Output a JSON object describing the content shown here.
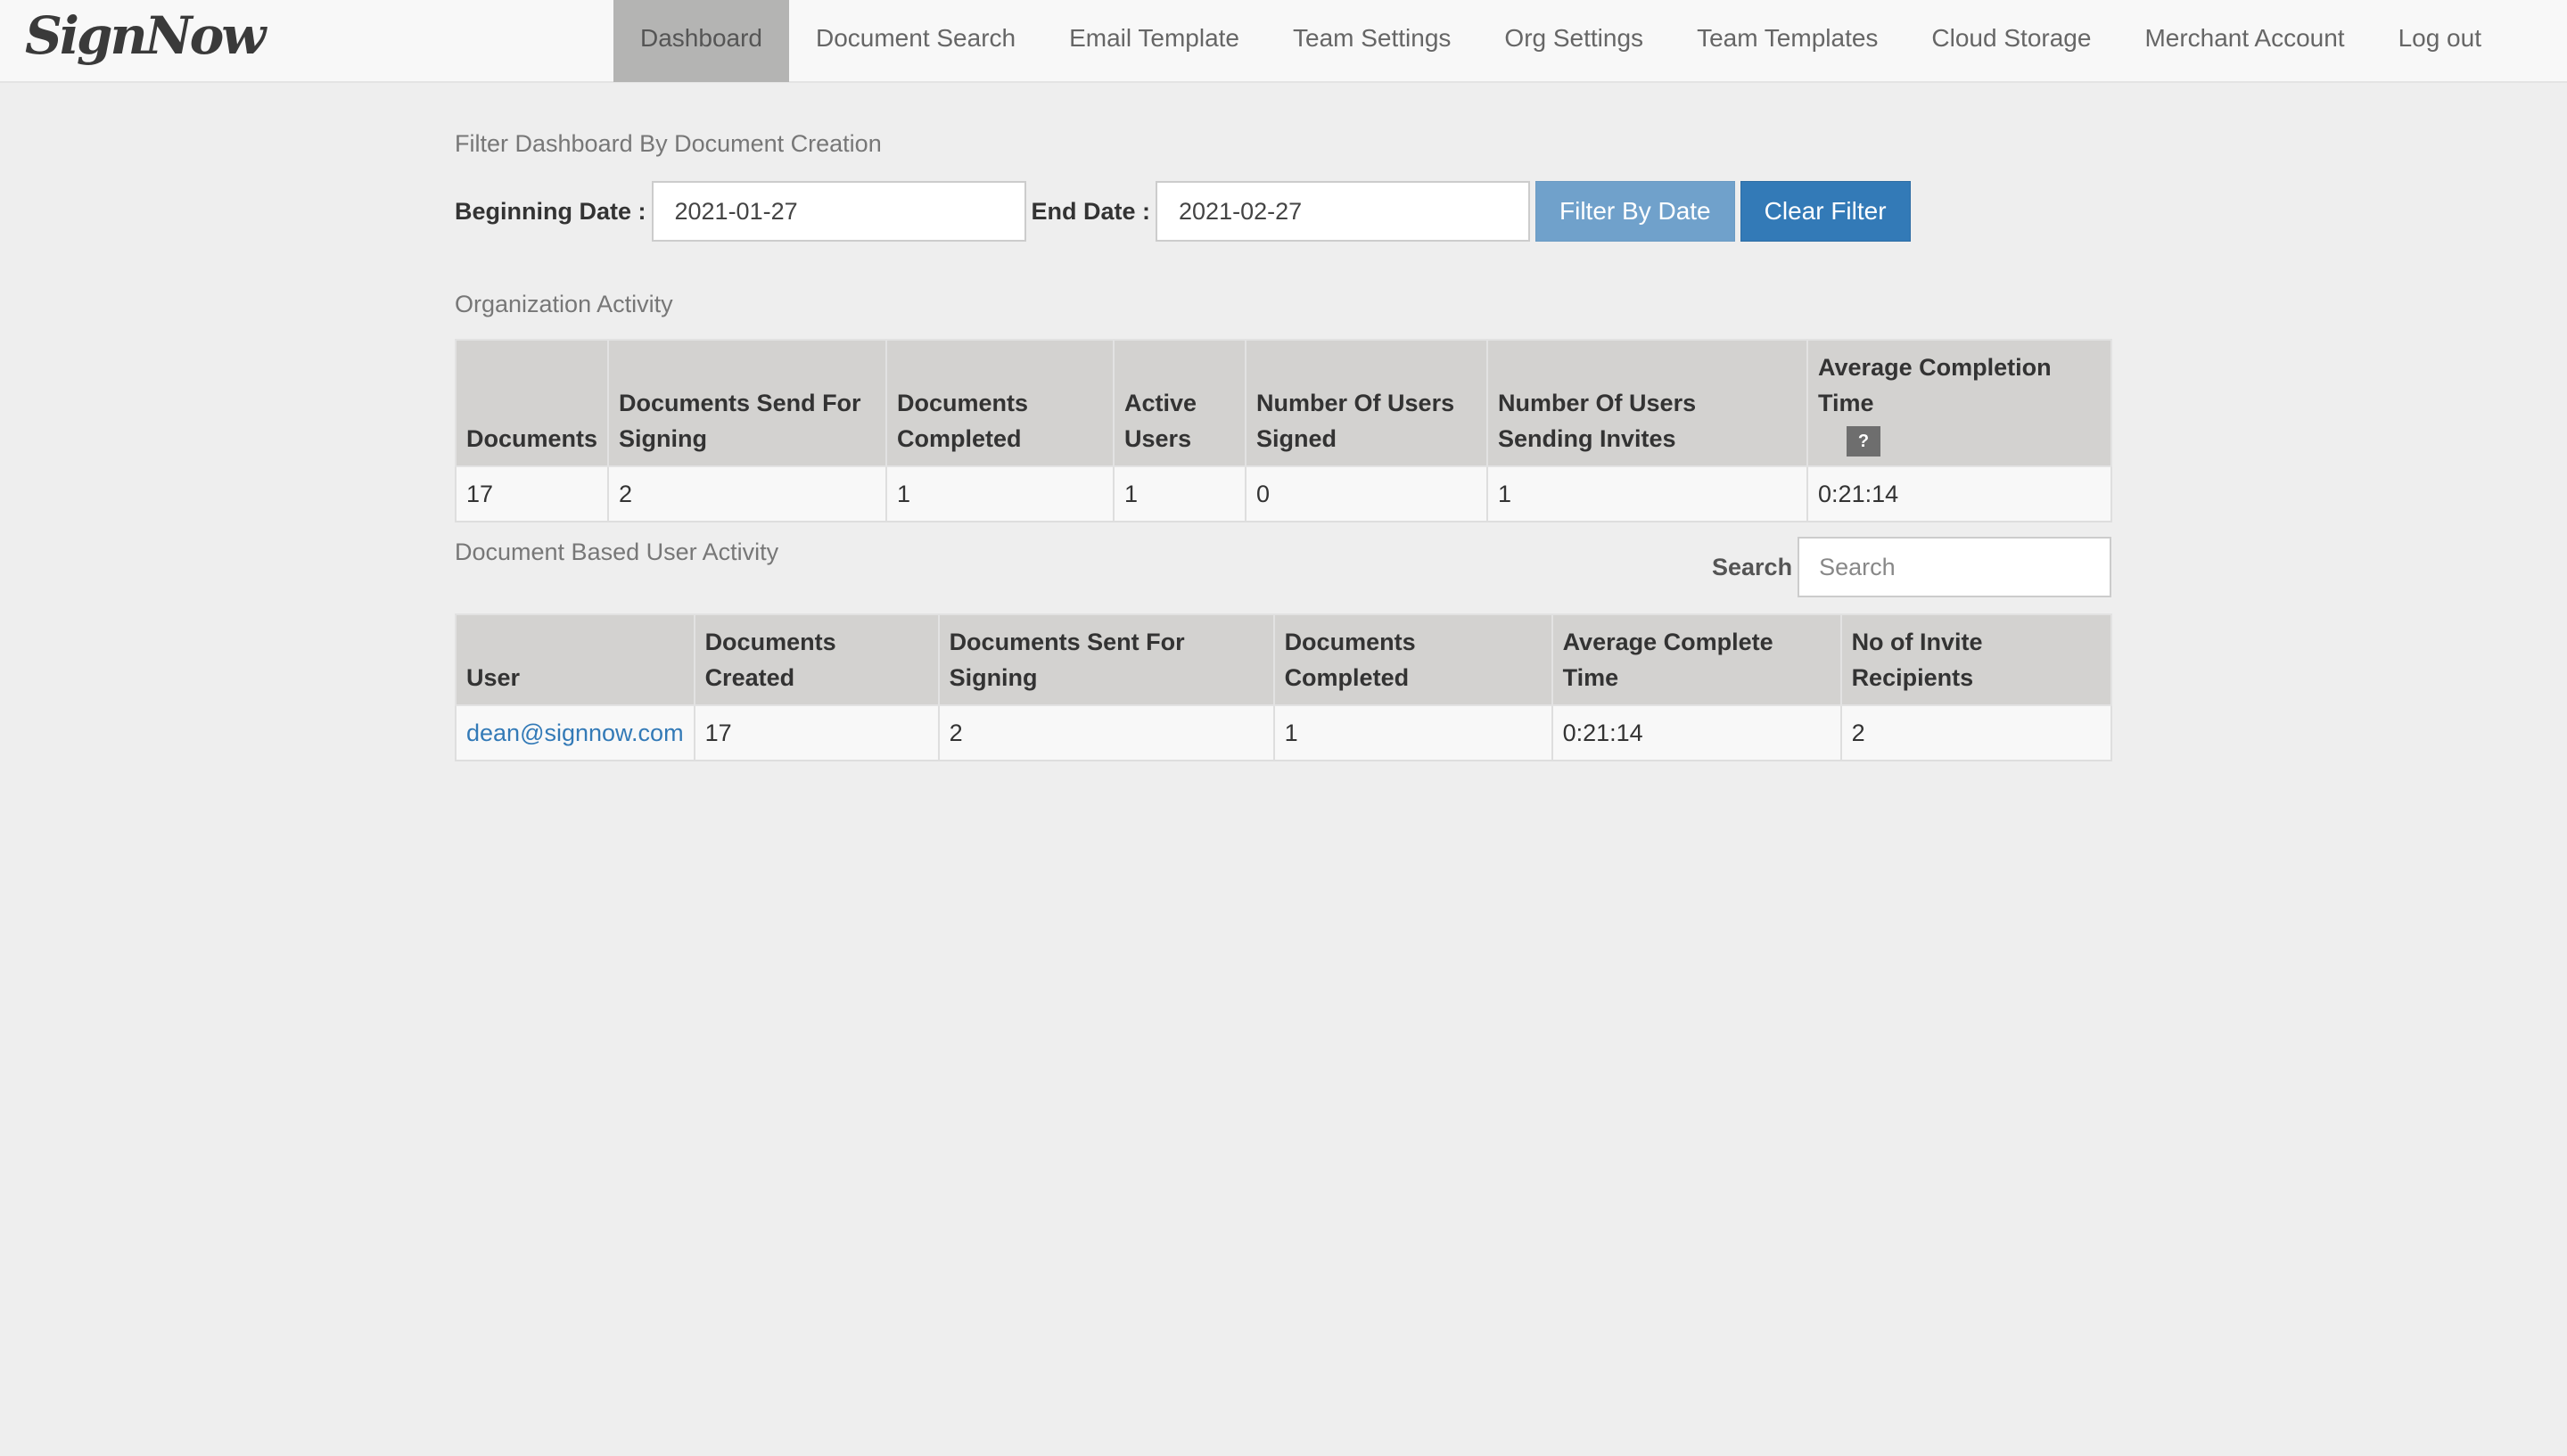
{
  "app": {
    "logo_text": "SignNow"
  },
  "nav": {
    "items": [
      {
        "label": "Dashboard",
        "active": true
      },
      {
        "label": "Document Search"
      },
      {
        "label": "Email Template"
      },
      {
        "label": "Team Settings"
      },
      {
        "label": "Org Settings"
      },
      {
        "label": "Team Templates"
      },
      {
        "label": "Cloud Storage"
      },
      {
        "label": "Merchant Account"
      },
      {
        "label": "Log out"
      }
    ]
  },
  "filter": {
    "title": "Filter Dashboard By Document Creation",
    "beginning_label": "Beginning Date :",
    "beginning_value": "2021-01-27",
    "end_label": "End Date :",
    "end_value": "2021-02-27",
    "filter_button": "Filter By Date",
    "clear_button": "Clear Filter"
  },
  "org_activity": {
    "title": "Organization Activity",
    "headers": [
      "Documents",
      "Documents Send For Signing",
      "Documents Completed",
      "Active Users",
      "Number Of Users Signed",
      "Number Of Users Sending Invites",
      "Average Completion Time"
    ],
    "help_badge": "?",
    "row": [
      "17",
      "2",
      "1",
      "1",
      "0",
      "1",
      "0:21:14"
    ]
  },
  "user_activity": {
    "title": "Document Based User Activity",
    "search_label": "Search",
    "search_placeholder": "Search",
    "search_value": "",
    "headers": [
      "User",
      "Documents Created",
      "Documents Sent For Signing",
      "Documents Completed",
      "Average Complete Time",
      "No of Invite Recipients"
    ],
    "rows": [
      [
        "dean@signnow.com",
        "17",
        "2",
        "1",
        "0:21:14",
        "2"
      ]
    ]
  },
  "colors": {
    "primary": "#337ab7",
    "primary_light": "#70a1cb",
    "nav_active": "#b4b4b3",
    "table_header": "#d3d2d0",
    "background": "#eeeeee"
  }
}
